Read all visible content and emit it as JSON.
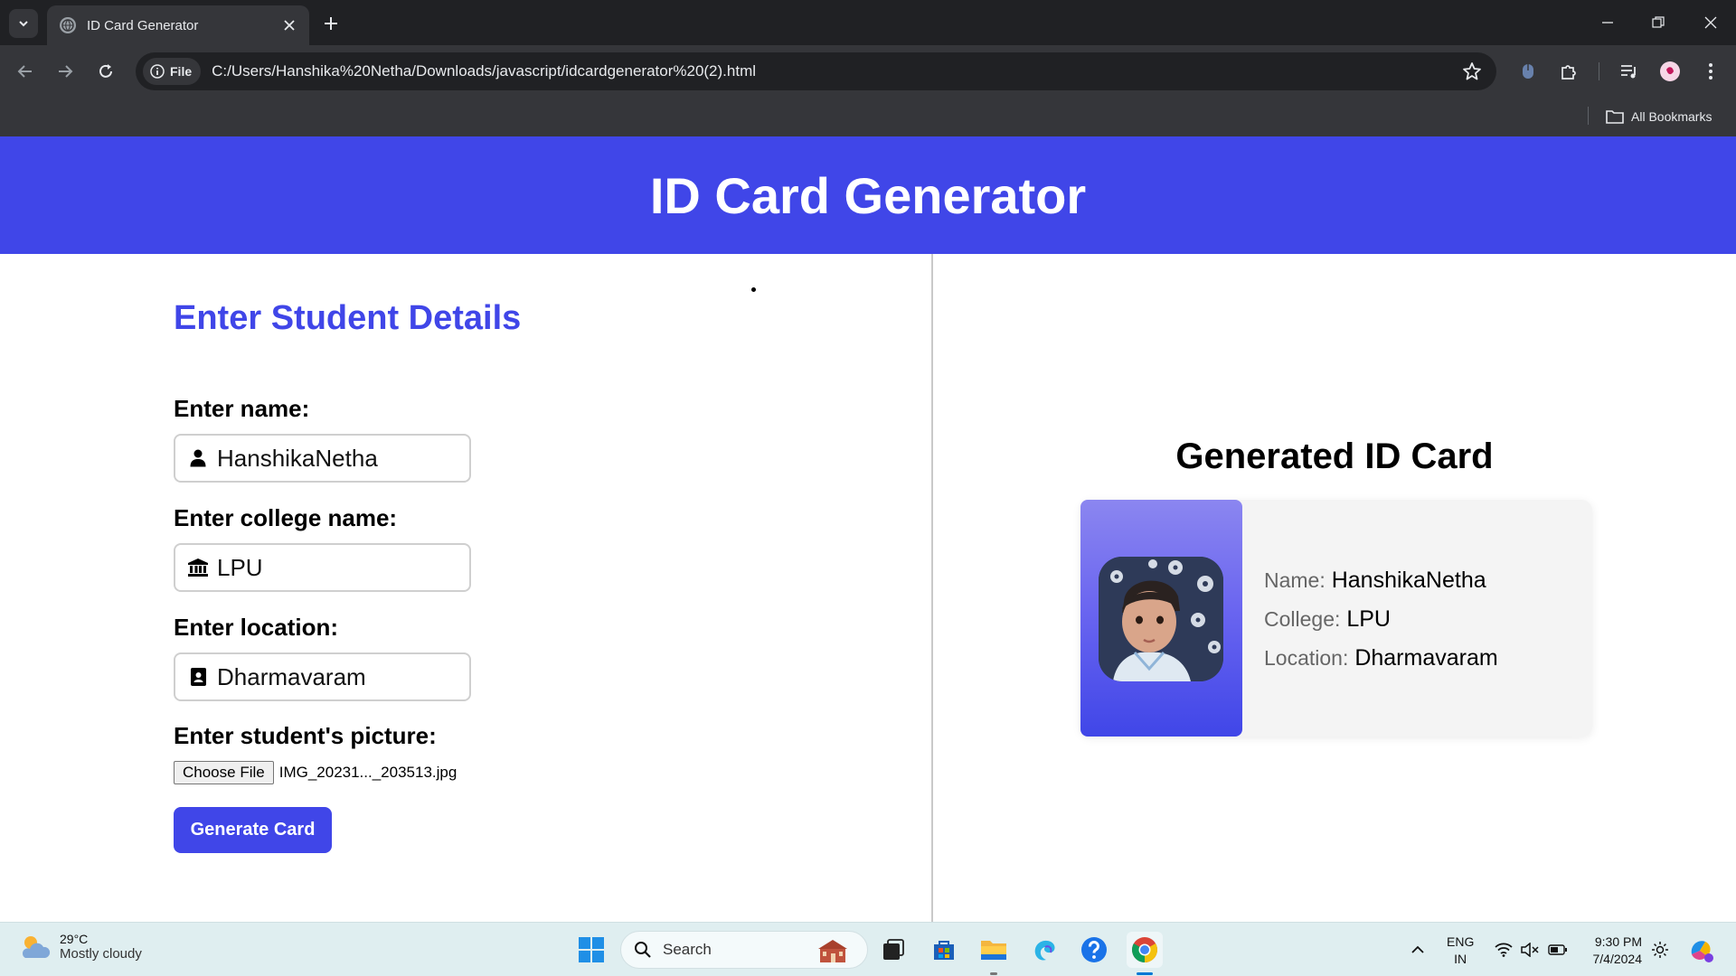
{
  "browser": {
    "tab_title": "ID Card Generator",
    "file_chip": "File",
    "url": "C:/Users/Hanshika%20Netha/Downloads/javascript/idcardgenerator%20(2).html",
    "bookmarks_label": "All Bookmarks"
  },
  "page": {
    "header_title": "ID Card Generator",
    "form": {
      "section_title": "Enter Student Details",
      "name_label": "Enter name:",
      "name_value": "HanshikaNetha",
      "college_label": "Enter college name:",
      "college_value": "LPU",
      "location_label": "Enter location:",
      "location_value": "Dharmavaram",
      "picture_label": "Enter student's picture:",
      "choose_file_label": "Choose File",
      "file_name": "IMG_20231..._203513.jpg",
      "generate_label": "Generate Card"
    },
    "card": {
      "title": "Generated ID Card",
      "name_label": "Name:",
      "name_value": "HanshikaNetha",
      "college_label": "College:",
      "college_value": "LPU",
      "location_label": "Location:",
      "location_value": "Dharmavaram"
    }
  },
  "taskbar": {
    "temperature": "29°C",
    "weather_condition": "Mostly cloudy",
    "search_placeholder": "Search",
    "language_line1": "ENG",
    "language_line2": "IN",
    "time": "9:30 PM",
    "date": "7/4/2024"
  },
  "colors": {
    "brand": "#4046e8",
    "browser_dark": "#202124",
    "browser_toolbar": "#35363a",
    "taskbar_bg": "#dfeef0"
  },
  "icons": [
    "tab-search-icon",
    "globe-icon",
    "close-icon",
    "plus-icon",
    "minimize-icon",
    "restore-icon",
    "back-arrow-icon",
    "forward-arrow-icon",
    "reload-icon",
    "info-icon",
    "star-icon",
    "extension-icon",
    "puzzle-icon",
    "media-icon",
    "profile-avatar",
    "menu-dots-icon",
    "folder-icon",
    "user-icon",
    "institution-icon",
    "address-card-icon",
    "weather-icon",
    "windows-start-icon",
    "search-icon",
    "chevron-up-icon",
    "wifi-icon",
    "speaker-muted-icon",
    "battery-icon"
  ]
}
